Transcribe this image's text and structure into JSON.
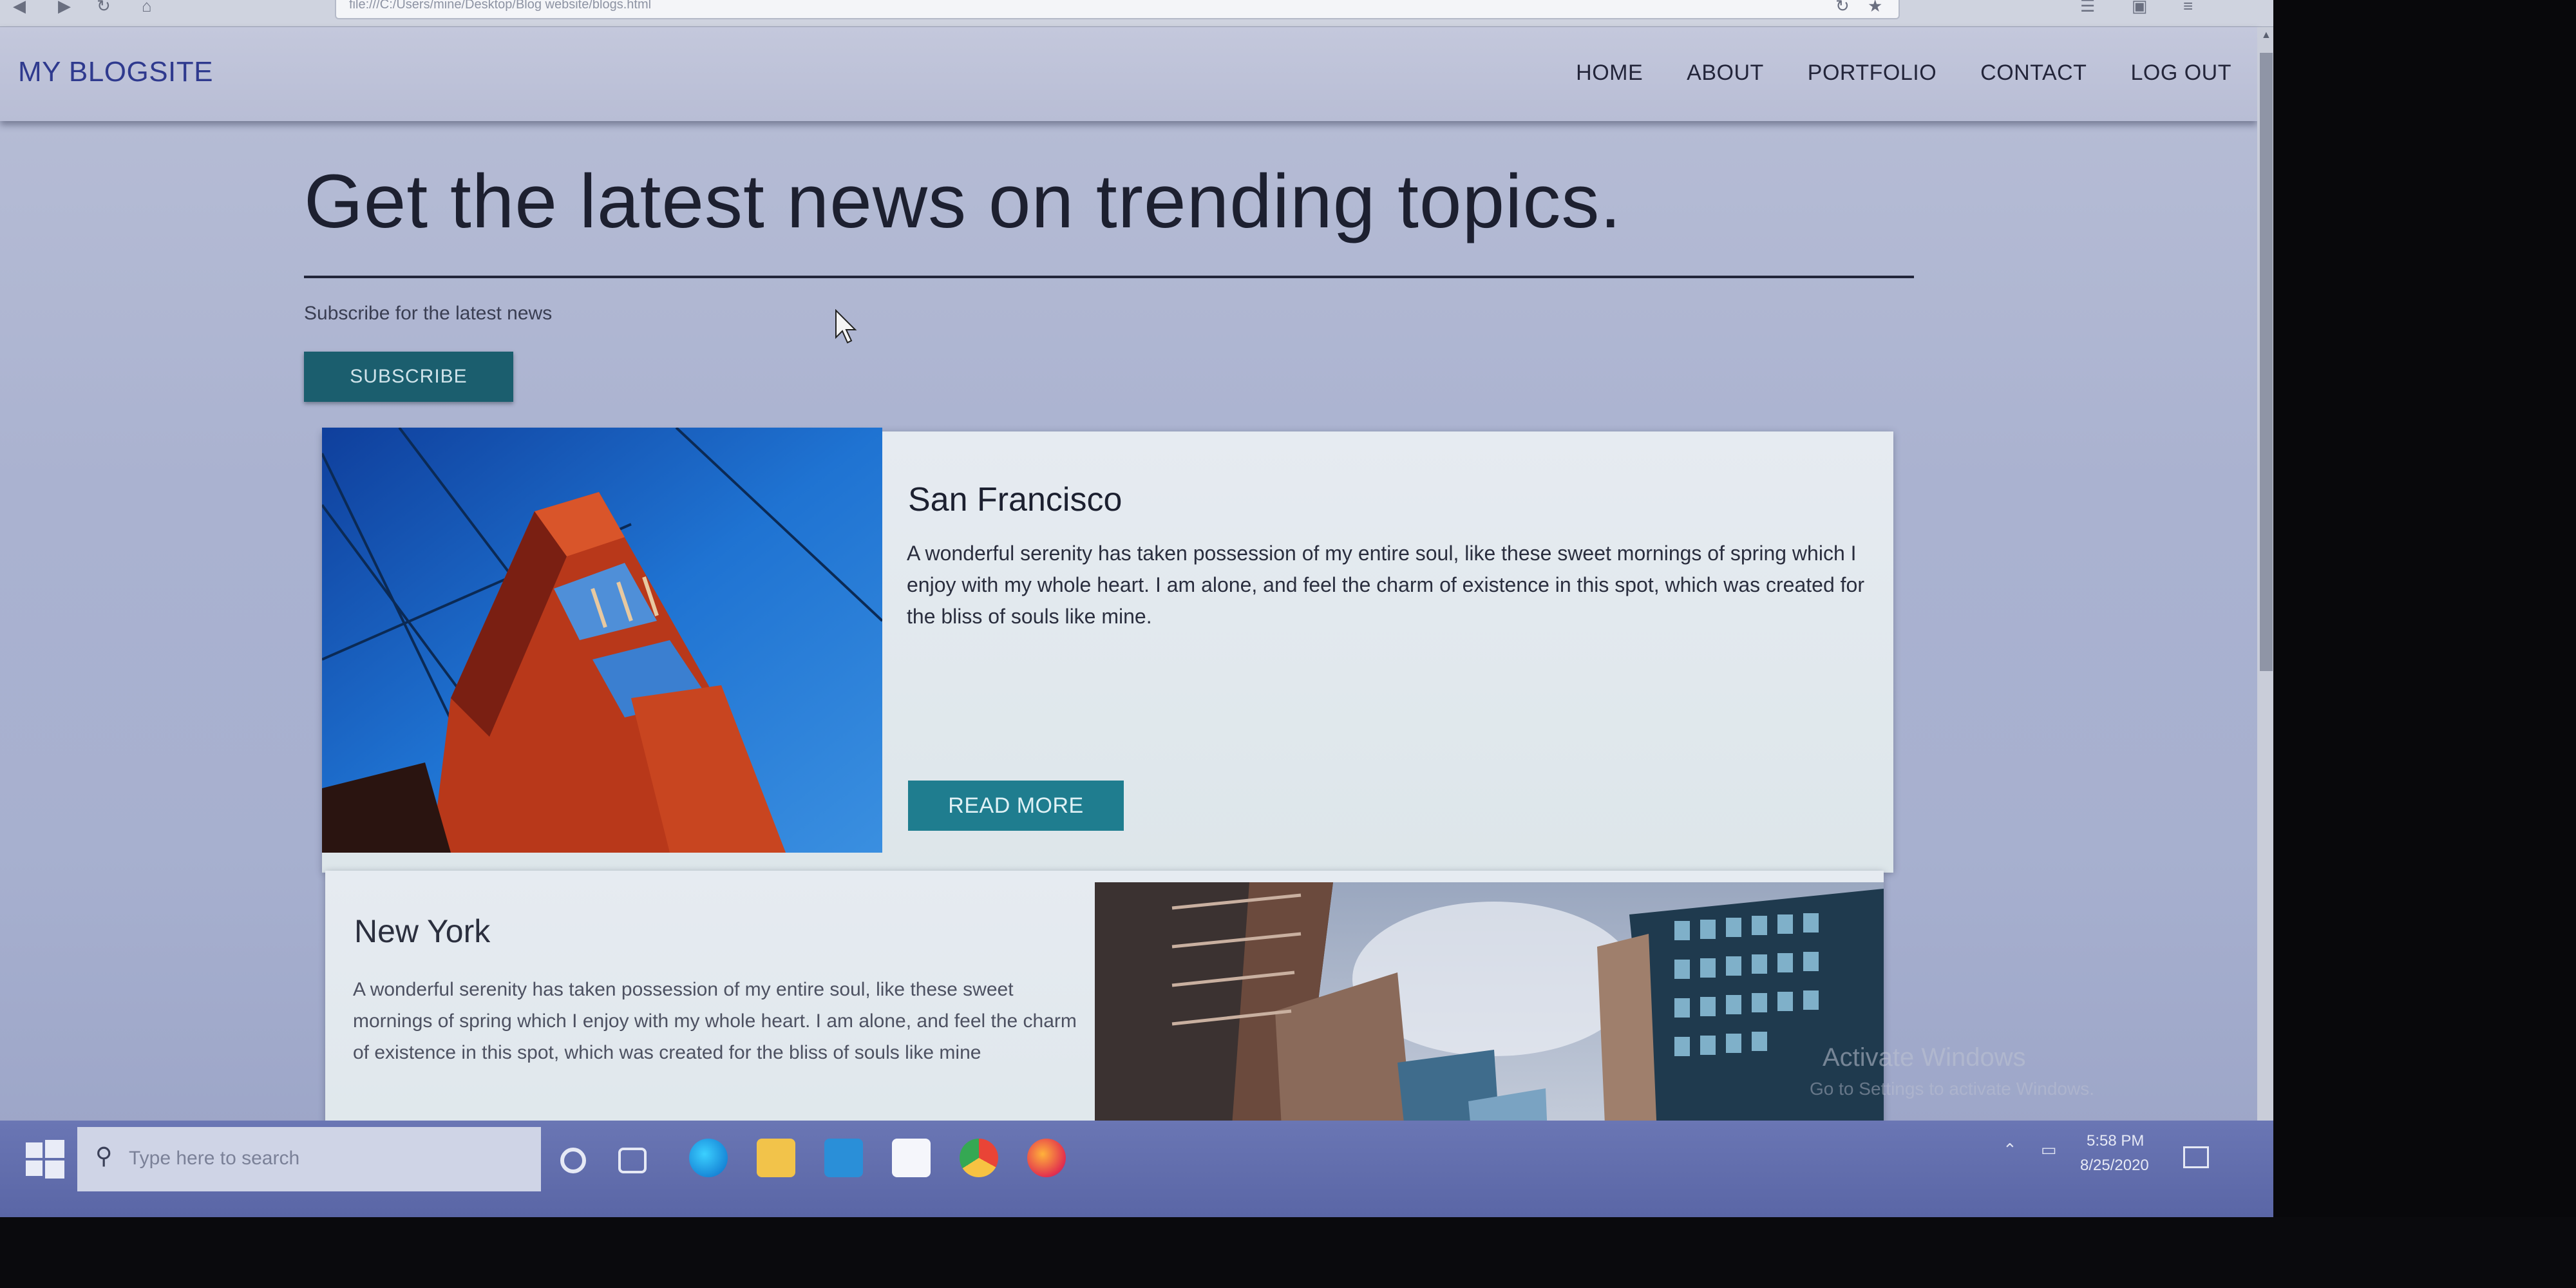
{
  "browser": {
    "url": "file:///C:/Users/mine/Desktop/Blog website/blogs.html"
  },
  "navbar": {
    "brand": "MY BLOGSITE",
    "links": [
      "HOME",
      "ABOUT",
      "PORTFOLIO",
      "CONTACT",
      "LOG OUT"
    ]
  },
  "hero": {
    "title": "Get the latest news on trending topics.",
    "subtitle": "Subscribe for the latest news",
    "button": "SUBSCRIBE"
  },
  "posts": [
    {
      "title": "San Francisco",
      "body": "A wonderful serenity has taken possession of my entire soul, like these sweet mornings of spring which I enjoy with my whole heart. I am alone, and feel the charm of existence in this spot, which was created for the bliss of souls like mine.",
      "button": "READ MORE"
    },
    {
      "title": "New York",
      "body": "A wonderful serenity has taken possession of my entire soul, like these sweet mornings of spring which I enjoy with my whole heart. I am alone, and feel the charm of existence in this spot, which was created for the bliss of souls like mine"
    }
  ],
  "watermark": {
    "line1": "Activate Windows",
    "line2": "Go to Settings to activate Windows."
  },
  "taskbar": {
    "search_placeholder": "Type here to search",
    "time": "5:58 PM",
    "date": "8/25/2020"
  },
  "colors": {
    "subscribe": "#1b5e6e",
    "read_more": "#1f7d8f",
    "brand": "#2f3a8e",
    "taskbar": "#5a66a6"
  }
}
